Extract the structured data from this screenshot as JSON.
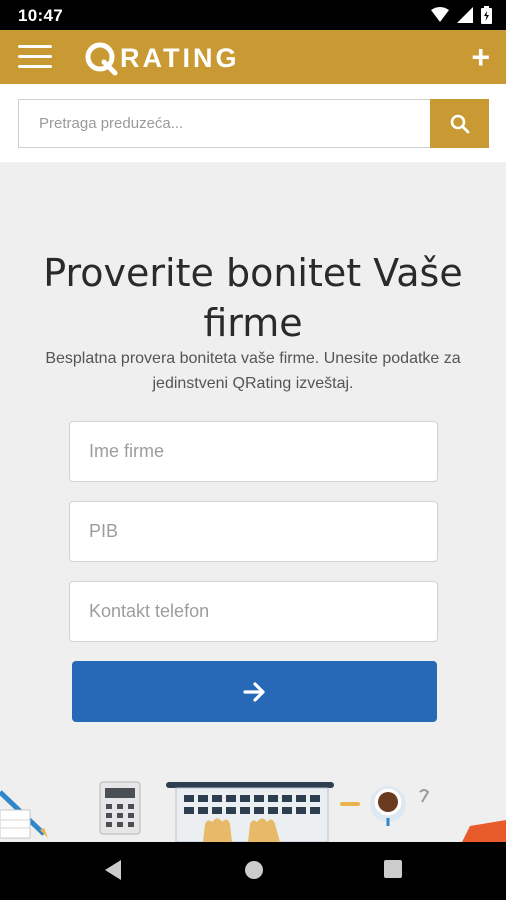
{
  "status_bar": {
    "time": "10:47"
  },
  "app_bar": {
    "logo_letter": "Q",
    "logo_rest": "RATING"
  },
  "search": {
    "placeholder": "Pretraga preduzeća..."
  },
  "form": {
    "title": "Proverite bonitet Vaše firme",
    "subtitle": "Besplatna provera boniteta vaše firme. Unesite podatke za jedinstveni QRating izveštaj.",
    "fields": [
      {
        "placeholder": "Ime firme"
      },
      {
        "placeholder": "PIB"
      },
      {
        "placeholder": "Kontakt telefon"
      }
    ],
    "submit_icon": "arrow-right-icon"
  },
  "colors": {
    "brand_gold": "#c99a33",
    "submit_blue": "#2769b6",
    "background": "#efefef"
  },
  "icons": [
    "menu-icon",
    "add-icon",
    "search-icon",
    "wifi-icon",
    "signal-icon",
    "battery-icon",
    "nav-back-icon",
    "nav-home-icon",
    "nav-recents-icon"
  ]
}
